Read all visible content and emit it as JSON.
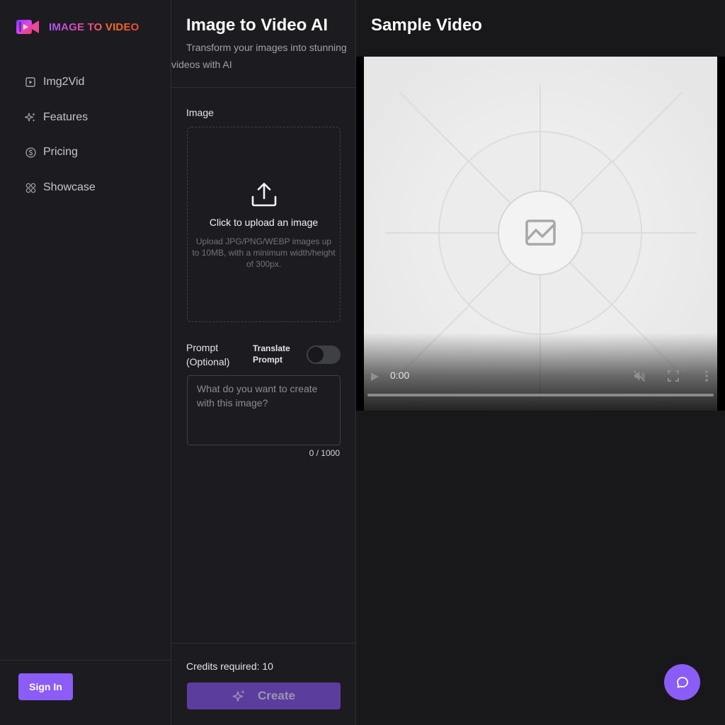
{
  "brand": {
    "name": "IMAGE TO VIDEO"
  },
  "sidebar": {
    "items": [
      {
        "label": "Img2Vid",
        "icon": "play-square-icon"
      },
      {
        "label": "Features",
        "icon": "sparkles-icon"
      },
      {
        "label": "Pricing",
        "icon": "dollar-circle-icon"
      },
      {
        "label": "Showcase",
        "icon": "grid-icon"
      }
    ],
    "sign_in_label": "Sign In"
  },
  "panel": {
    "title": "Image to Video AI",
    "subtitle": "Transform your images into stunning videos with AI",
    "image_label": "Image",
    "upload_title": "Click to upload an image",
    "upload_hint": "Upload JPG/PNG/WEBP images up to 10MB, with a minimum width/height of 300px.",
    "prompt_label": "Prompt (Optional)",
    "translate_label": "Translate Prompt",
    "translate_enabled": false,
    "prompt_value": "",
    "prompt_placeholder": "What do you want to create with this image?",
    "counter": "0 / 1000",
    "credits": "Credits required: 10",
    "create_label": "Create"
  },
  "right": {
    "title": "Sample Video",
    "video_time": "0:00",
    "video_muted": true
  },
  "colors": {
    "accent": "#8b5cf6",
    "create_disabled": "#5b3d9e",
    "background": "#18181b",
    "panel": "#1c1c20"
  }
}
